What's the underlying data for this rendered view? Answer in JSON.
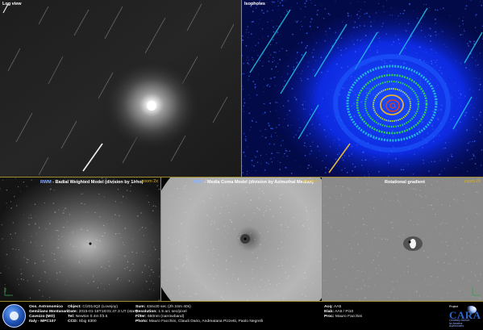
{
  "panels": {
    "log_view": {
      "title": "Log view"
    },
    "isophotes": {
      "title": "Isophotes"
    },
    "rwm": {
      "title_main": "RWM",
      "title_rest": " - Radial Weighted Model (division by 1/rho)",
      "zoom": "zoom 2x"
    },
    "mcm": {
      "title_main": "MCM",
      "title_rest": " - Media Coma Model (division by Azimuthal Median)",
      "zoom": "zoom 2x"
    },
    "rotational": {
      "title": "Rotational gradient",
      "zoom": "zoom 2x"
    }
  },
  "footer": {
    "observatory": [
      {
        "label": "Oss. Astronomico",
        "value": ""
      },
      {
        "label": "Gemiliano Montanari",
        "value": ""
      },
      {
        "label": "Cavezzo (MO)",
        "value": ""
      },
      {
        "label": "Italy - MPC107",
        "value": ""
      }
    ],
    "col1": [
      {
        "label": "Object:",
        "value": "C/2014Q2 (Lovejoy)"
      },
      {
        "label": "Date:",
        "value": "2015-01-18T18:01:47.3 UT (start)"
      },
      {
        "label": "Tel:",
        "value": "Newton 0.4m f/3.5"
      },
      {
        "label": "CCD:",
        "value": "Sbig 8300"
      }
    ],
    "col2": [
      {
        "label": "Sum:",
        "value": "434x20 sec (2h 24m 40s)"
      },
      {
        "label": "Resolution:",
        "value": "1.5 arc sec/pixel"
      },
      {
        "label": "Filter:",
        "value": "650nm (narrowband)"
      },
      {
        "label": "Photo:",
        "value": "Mauro Facchini, Claudi Dario, Andreatana Pizzetti, Paolo Negrelli"
      }
    ],
    "col3": [
      {
        "label": "Acq:",
        "value": "AA5"
      },
      {
        "label": "Elab:",
        "value": "AA5 / Pi10"
      },
      {
        "label": "Proc:",
        "value": "Mauro Facchini"
      }
    ],
    "cara": {
      "project": "Project",
      "brand": "CARA",
      "sub": "Cometary Archive\nfor Amateur\nAstronomers"
    }
  },
  "colors": {
    "frame": "#a08b2a",
    "zoom_text": "#d4b429",
    "isophote_bg": "#0a1cc8",
    "isophote_rings": [
      "#1e5cff",
      "#24b8d8",
      "#2fcf55",
      "#b6e03a",
      "#e8b030",
      "#e04020"
    ]
  },
  "icons": {
    "observatory_logo": "observatory-seal-icon",
    "cara_logo": "cara-logo-icon",
    "corner_axes": "orientation-axes-icon"
  }
}
